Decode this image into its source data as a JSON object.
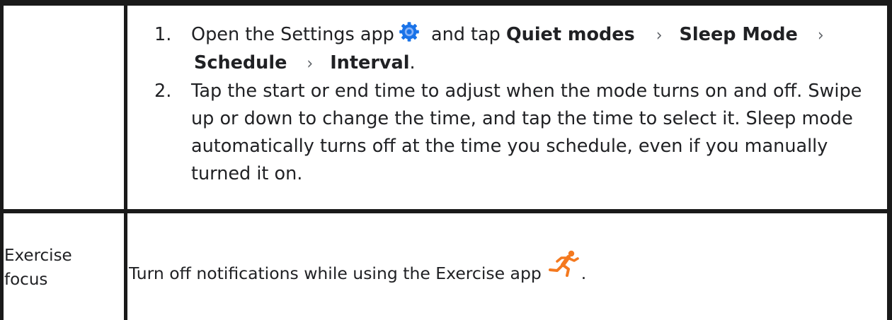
{
  "row1": {
    "steps": [
      {
        "num": "1.",
        "text_before_icon": "Open the Settings app",
        "icon": "settings-gear-icon",
        "text_after_icon": " and tap ",
        "path": [
          "Quiet modes",
          "Sleep Mode",
          "Schedule",
          "Interval"
        ],
        "end_punct": "."
      },
      {
        "num": "2.",
        "text": "Tap the start or end time to adjust when the mode turns on and off. Swipe up or down to change the time, and tap the time to select it. Sleep mode automatically turns off at the time you schedule, even if you manually turned it on."
      }
    ]
  },
  "row2": {
    "label": "Exercise focus",
    "text": "Turn off notifications while using the Exercise app",
    "icon": "exercise-runner-icon",
    "end_punct": "."
  },
  "colors": {
    "border": "#1a1a1a",
    "text": "#202124",
    "chevron": "#5f6368",
    "settings_icon": "#1a73e8",
    "exercise_icon": "#f4791f"
  }
}
